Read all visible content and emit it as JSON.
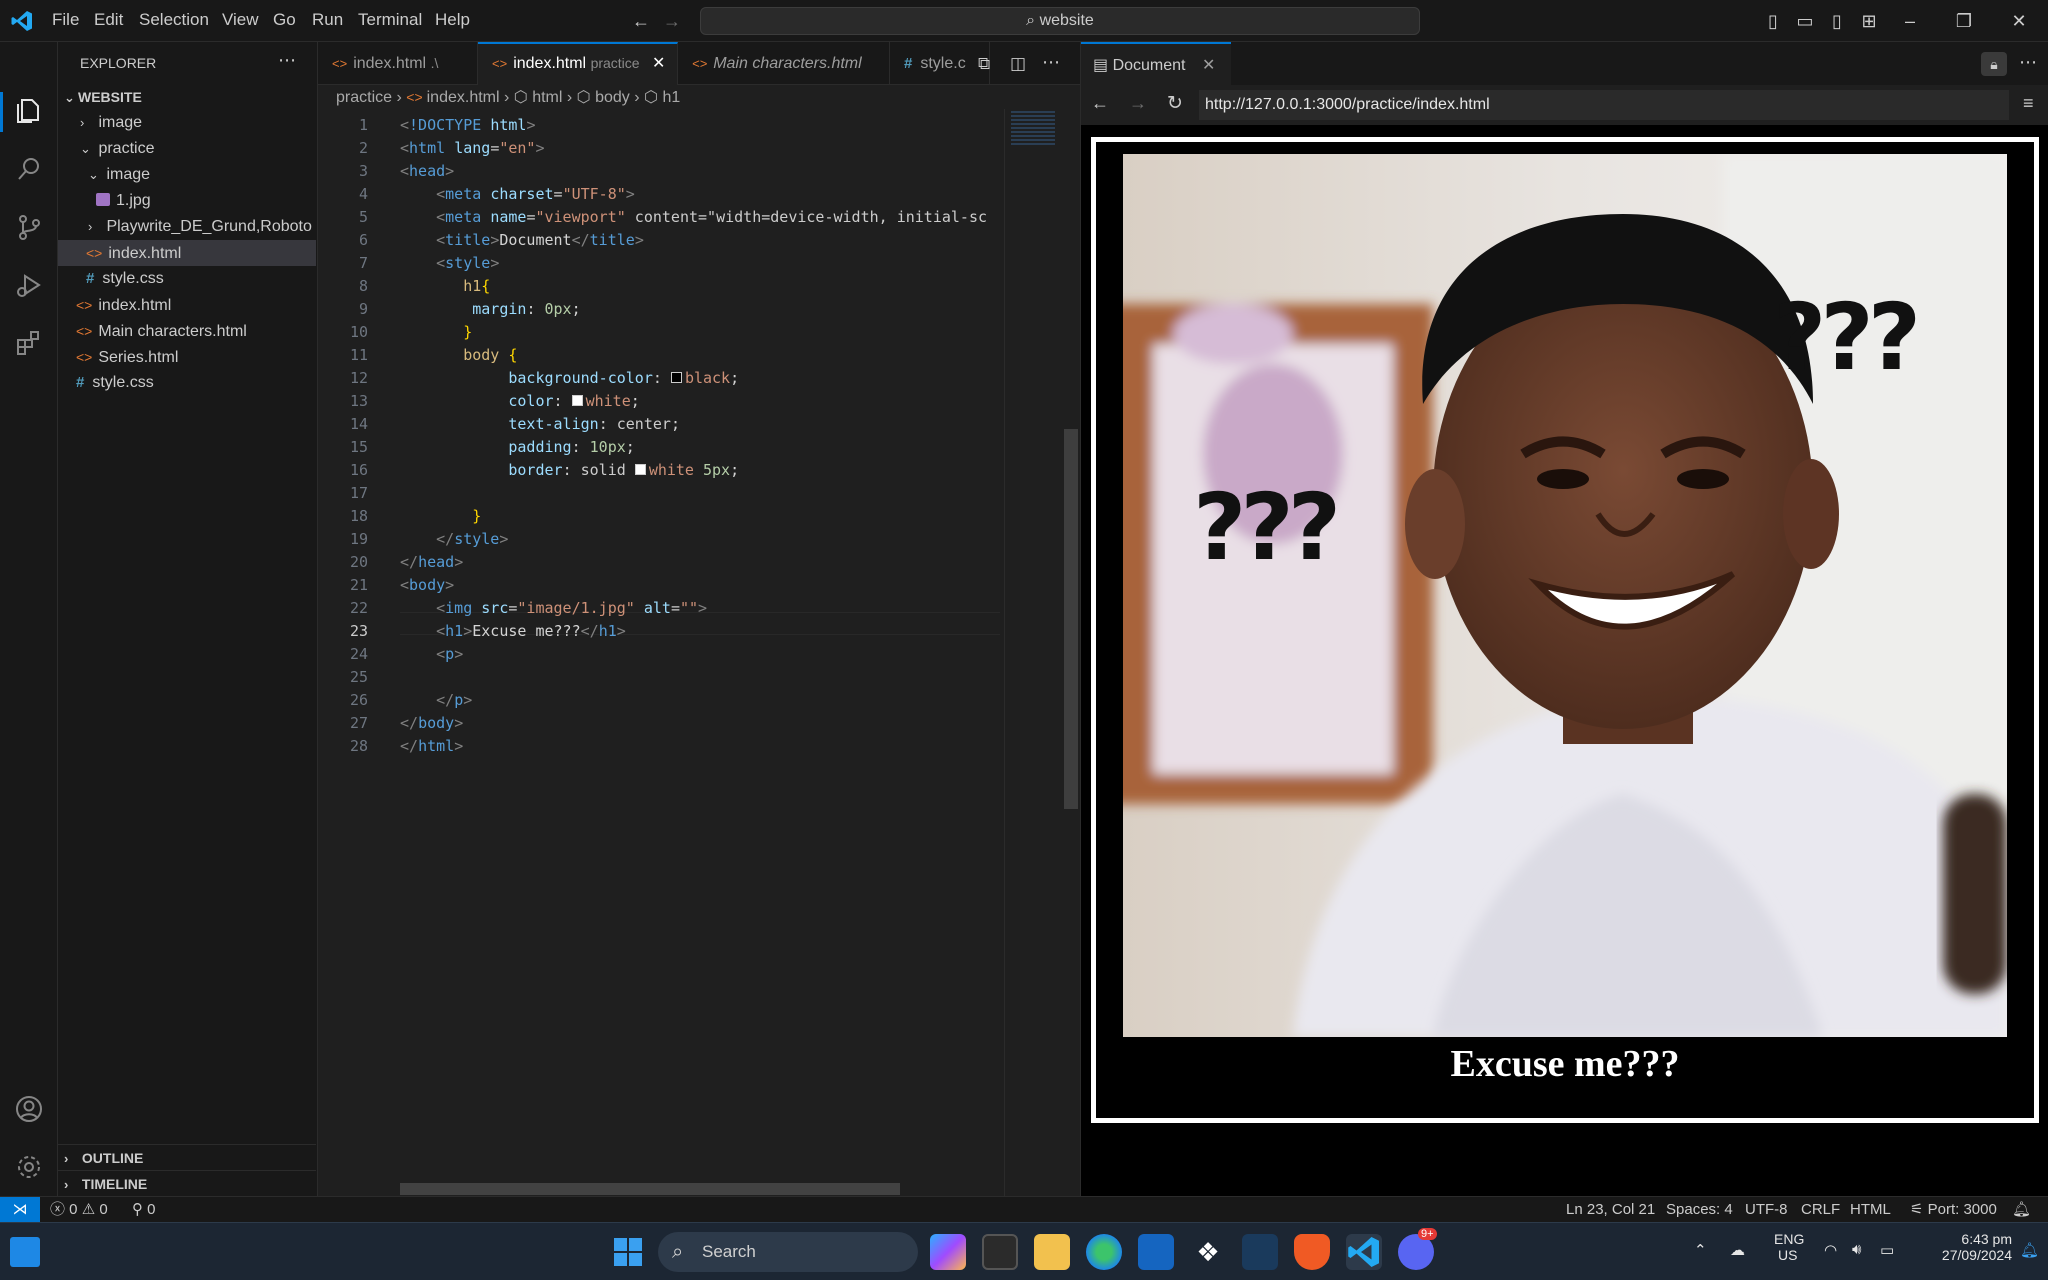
{
  "menu": [
    "File",
    "Edit",
    "Selection",
    "View",
    "Go",
    "Run",
    "Terminal",
    "Help"
  ],
  "command_center": "website",
  "sidebar": {
    "title": "EXPLORER",
    "root": "WEBSITE",
    "items": [
      {
        "label": "image",
        "kind": "folder-closed"
      },
      {
        "label": "practice",
        "kind": "folder-open"
      },
      {
        "label": "image",
        "kind": "folder-open"
      },
      {
        "label": "1.jpg",
        "kind": "image"
      },
      {
        "label": "Playwrite_DE_Grund,Roboto",
        "kind": "folder-closed"
      },
      {
        "label": "index.html",
        "kind": "html"
      },
      {
        "label": "style.css",
        "kind": "css"
      },
      {
        "label": "index.html",
        "kind": "html"
      },
      {
        "label": "Main characters.html",
        "kind": "html"
      },
      {
        "label": "Series.html",
        "kind": "html"
      },
      {
        "label": "style.css",
        "kind": "css"
      }
    ],
    "sections": [
      "OUTLINE",
      "TIMELINE"
    ]
  },
  "tabs": [
    {
      "label": "index.html",
      "hint": ".\\"
    },
    {
      "label": "index.html",
      "hint": "practice"
    },
    {
      "label": "Main characters.html",
      "hint": ""
    },
    {
      "label": "style.c",
      "hint": ""
    }
  ],
  "breadcrumb": [
    "practice",
    "index.html",
    "html",
    "body",
    "h1"
  ],
  "code_lines": [
    "<!DOCTYPE html>",
    "<html lang=\"en\">",
    "<head>",
    "    <meta charset=\"UTF-8\">",
    "    <meta name=\"viewport\" content=\"width=device-width, initial-sc",
    "    <title>Document</title>",
    "    <style>",
    "       h1{",
    "        margin: 0px;",
    "       }",
    "       body {",
    "            background-color: black;",
    "            color: white;",
    "            text-align: center;",
    "            padding: 10px;",
    "            border: solid white 5px;",
    "",
    "        }",
    "    </style>",
    "</head>",
    "<body>",
    "    <img src=\"image/1.jpg\" alt=\"\">",
    "    <h1>Excuse me???</h1>",
    "    <p>",
    "",
    "    </p>",
    "</body>",
    "</html>"
  ],
  "line_numbers": [
    "1",
    "2",
    "3",
    "4",
    "5",
    "6",
    "7",
    "8",
    "9",
    "10",
    "11",
    "12",
    "13",
    "14",
    "15",
    "16",
    "17",
    "18",
    "19",
    "20",
    "21",
    "22",
    "23",
    "24",
    "25",
    "26",
    "27",
    "28"
  ],
  "preview": {
    "tab_label": "Document",
    "url": "http://127.0.0.1:3000/practice/index.html",
    "heading": "Excuse me???",
    "image_text": "???"
  },
  "status": {
    "errors": "0",
    "warnings": "0",
    "ports": "0",
    "position": "Ln 23, Col 21",
    "spaces": "Spaces: 4",
    "encoding": "UTF-8",
    "eol": "CRLF",
    "language": "HTML",
    "port": "Port: 3000"
  },
  "taskbar": {
    "search": "Search",
    "lang_top": "ENG",
    "lang_bottom": "US",
    "time": "6:43 pm",
    "date": "27/09/2024",
    "badge": "9+"
  },
  "colors": {
    "accent": "#0078d4",
    "editor_bg": "#1f1f1f",
    "chrome_bg": "#181818"
  }
}
